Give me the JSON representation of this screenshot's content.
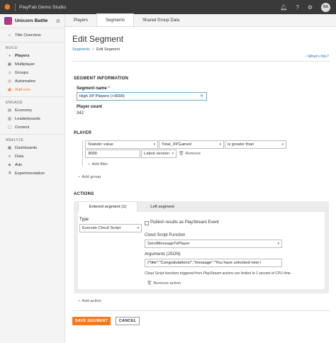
{
  "topbar": {
    "app_title": "PlayFab Demo Studio",
    "avatar_initials": "NA",
    "bell_icon": "bell-icon",
    "help_icon": "question-icon",
    "settings_icon": "gear-icon"
  },
  "sidebar": {
    "title": "Unicorn Battle",
    "overview": "Title Overview",
    "sections": [
      {
        "heading": "BUILD",
        "items": [
          "Players",
          "Multiplayer",
          "Groups",
          "Automation",
          "Add-ons"
        ]
      },
      {
        "heading": "ENGAGE",
        "items": [
          "Economy",
          "Leaderboards",
          "Content"
        ]
      },
      {
        "heading": "ANALYZE",
        "items": [
          "Dashboards",
          "Data",
          "Ads",
          "Experimentation"
        ]
      }
    ]
  },
  "tabs": [
    "Players",
    "Segments",
    "Shared Group Data"
  ],
  "page": {
    "title": "Edit Segment",
    "breadcrumb": {
      "parent": "Segments",
      "separator": ">",
      "current": "Edit Segment"
    },
    "whats_this": "What's this?"
  },
  "segment_info": {
    "heading": "SEGMENT INFORMATION",
    "name_label": "Segment name",
    "required_mark": "*",
    "name_value": "High XP Players (>3000)",
    "count_label": "Player count",
    "count_value": "342"
  },
  "player": {
    "heading": "PLAYER",
    "filter": {
      "field": "Statistic value",
      "statistic": "Total_XPGained",
      "operator": "is greater than",
      "value": "3000",
      "version": "Latest version"
    },
    "remove_label": "Remove",
    "add_filter": "Add filter",
    "add_group": "Add group"
  },
  "actions": {
    "heading": "ACTIONS",
    "tabs": [
      "Entered segment (1)",
      "Left segment"
    ],
    "type_label": "Type",
    "type_value": "Execute Cloud Script",
    "publish_label": "Publish results as PlayStream Event",
    "function_label": "Cloud Script Function",
    "function_value": "SendMessageToPlayer",
    "args_label": "Arguments (JSON)",
    "args_value": "{\"title\":\"Congratulations!\",\"message\":\"You have unlocked new l",
    "note": "Cloud Script functions triggered from PlayStream actions are limited to 1 second of CPU time.",
    "remove_action": "Remove action",
    "add_action": "Add action"
  },
  "buttons": {
    "save": "SAVE SEGMENT",
    "cancel": "CANCEL"
  },
  "colors": {
    "accent": "#f47920",
    "link": "#2a7ab0",
    "topbar": "#3a3a3a"
  }
}
